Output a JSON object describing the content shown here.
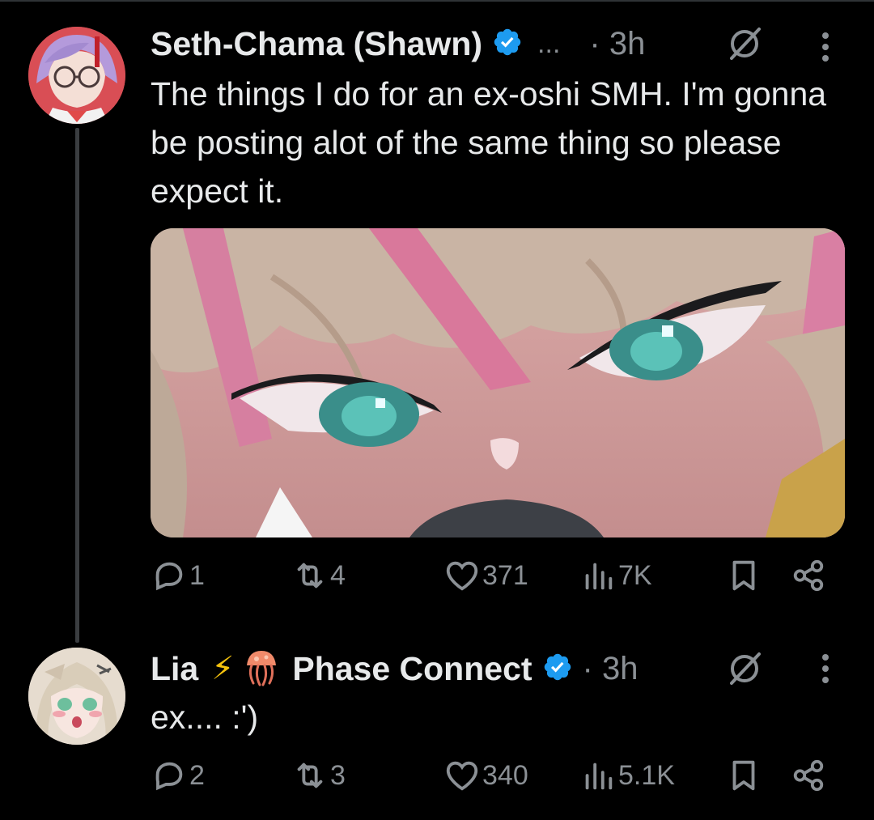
{
  "tweets": [
    {
      "author": "Seth-Chama (Shawn)",
      "truncation": "...",
      "time": "· 3h",
      "text": "The things I do for an ex-oshi SMH. I'm gonna be posting alot of the same thing so please expect it.",
      "stats": {
        "replies": "1",
        "reposts": "4",
        "likes": "371",
        "views": "7K"
      }
    },
    {
      "author": "Lia",
      "author_emoji": "⚡",
      "author_suffix": "Phase Connect",
      "time": "· 3h",
      "text": "ex.... :')",
      "stats": {
        "replies": "2",
        "reposts": "3",
        "likes": "340",
        "views": "5.1K"
      }
    }
  ],
  "colors": {
    "background": "#000000",
    "text": "#e7e9ea",
    "muted": "#8b9095",
    "verified": "#1d9bf0",
    "lightning": "#f4c20d"
  }
}
